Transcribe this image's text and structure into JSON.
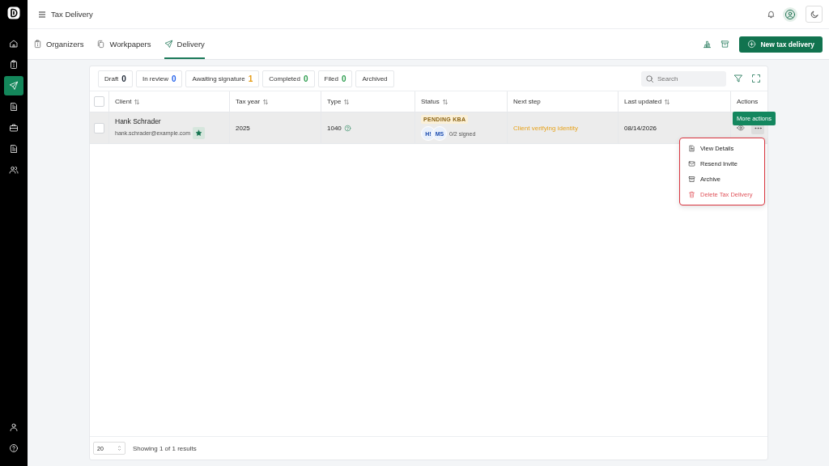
{
  "sidebar": {
    "items": [
      {
        "selected": false
      },
      {
        "selected": false
      },
      {
        "selected": true
      },
      {
        "selected": false
      },
      {
        "selected": false
      },
      {
        "selected": false
      },
      {
        "selected": false
      }
    ],
    "bottom_items": [
      {
        "selected": false
      },
      {
        "selected": false
      }
    ]
  },
  "header": {
    "title": "Tax Delivery"
  },
  "tabs": [
    {
      "label": "Organizers",
      "selected": false
    },
    {
      "label": "Workpapers",
      "selected": false
    },
    {
      "label": "Delivery",
      "selected": true
    }
  ],
  "primary_button": "New tax delivery",
  "filters": [
    {
      "label": "Draft",
      "count": "0",
      "color": "#1f2937"
    },
    {
      "label": "In review",
      "count": "0",
      "color": "#2563eb"
    },
    {
      "label": "Awaiting signature",
      "count": "1",
      "color": "#e59a12"
    },
    {
      "label": "Completed",
      "count": "0",
      "color": "#2e9d4f"
    },
    {
      "label": "Filed",
      "count": "0",
      "color": "#2e9d4f"
    },
    {
      "label": "Archived"
    }
  ],
  "search": {
    "placeholder": "Search"
  },
  "table": {
    "select_all": {
      "checked": false
    },
    "columns": [
      {
        "label": "Client",
        "sortable": true
      },
      {
        "label": "Tax year",
        "sortable": true
      },
      {
        "label": "Type",
        "sortable": true
      },
      {
        "label": "Status",
        "sortable": true
      },
      {
        "label": "Next step",
        "sortable": false
      },
      {
        "label": "Last updated",
        "sortable": true
      },
      {
        "label": "Actions",
        "sortable": false
      }
    ],
    "rows": [
      {
        "checked": false,
        "hovered": true,
        "client_name": "Hank Schrader",
        "client_email": "hank.schrader@example.com",
        "starred": true,
        "tax_year": "2025",
        "type": "1040",
        "status_badge": "PENDING KBA",
        "signers": [
          "H!",
          "MS"
        ],
        "signed": "0/2 signed",
        "next_step": "Client verifying identity",
        "last_updated": "08/14/2026"
      }
    ]
  },
  "tooltip": "More actions",
  "menu": [
    {
      "label": "View Details",
      "kind": "normal"
    },
    {
      "label": "Resend Invite",
      "kind": "normal"
    },
    {
      "label": "Archive",
      "kind": "normal"
    },
    {
      "label": "Delete Tax Delivery",
      "kind": "danger"
    }
  ],
  "footer": {
    "page_size": "20",
    "summary": "Showing 1 of 1 results"
  }
}
